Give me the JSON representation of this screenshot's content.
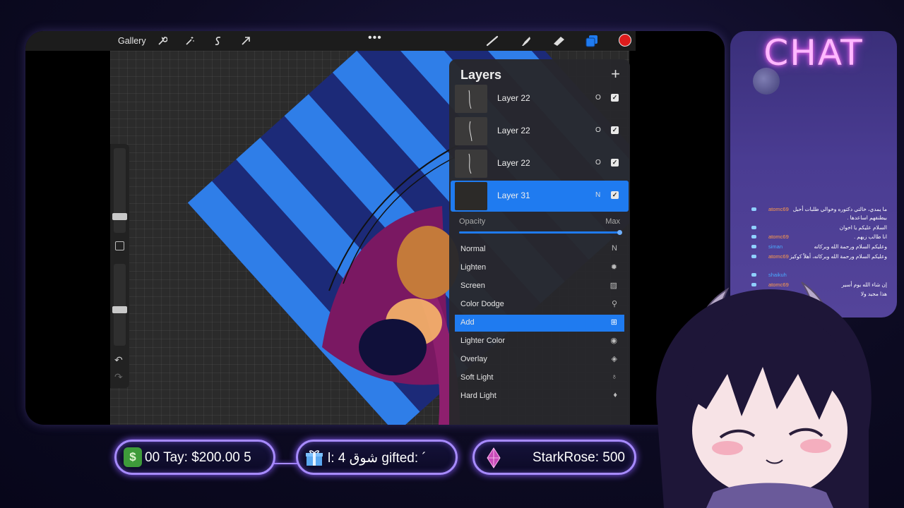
{
  "toolbar": {
    "gallery_label": "Gallery",
    "more_label": "•••",
    "icons": [
      "wrench-icon",
      "magic-wand-icon",
      "selection-icon",
      "transform-arrow-icon",
      "brush-icon",
      "smudge-icon",
      "eraser-icon",
      "layers-icon"
    ],
    "color_swatch": "#dd1c1c"
  },
  "layers": {
    "title": "Layers",
    "add_symbol": "+",
    "items": [
      {
        "name": "Layer 22",
        "mode": "O",
        "checked": "✓"
      },
      {
        "name": "Layer 22",
        "mode": "O",
        "checked": "✓"
      },
      {
        "name": "Layer 22",
        "mode": "O",
        "checked": "✓"
      },
      {
        "name": "Layer 31",
        "mode": "N",
        "checked": "✓"
      }
    ],
    "opacity_label": "Opacity",
    "opacity_max": "Max",
    "opacity_value": 1.0,
    "blend_modes": [
      "Normal",
      "Lighten",
      "Screen",
      "Color Dodge",
      "Add",
      "Lighter Color",
      "Overlay",
      "Soft Light",
      "Hard Light"
    ],
    "selected_blend": "Add"
  },
  "sidebar": {
    "undo_symbol": "↶",
    "redo_symbol": "↷"
  },
  "chat": {
    "title": "CHAT",
    "messages": [
      {
        "user": "atomc69",
        "text": "ما يمدي، خالتي دكتوره وخوالي طلبات أحبل"
      },
      {
        "user": "",
        "text": "بيطنقهم اساعدها ."
      },
      {
        "user": "",
        "text": "السلام عليكم يا اخوان"
      },
      {
        "user": "atomc69",
        "text": "انا طالب زيهم ."
      },
      {
        "user": "siman",
        "text": "وعليكم السلام ورحمة الله وبركاته"
      },
      {
        "user": "atomc69",
        "text": "وعليكم السلام ورحمة الله وبركاته، أهلاً كوكيز"
      },
      {
        "user": "shaikuh",
        "text": ""
      },
      {
        "user": "atomc69",
        "text": "إن شاء الله يوم أسير"
      },
      {
        "user": "",
        "text": "هذا مجيد ولا"
      }
    ]
  },
  "stats": {
    "tip_text": "00   Tay: $200.00      5",
    "money_symbol": "$",
    "gift_text": "l: 4          شوق gifted: ´",
    "sub_text": "StarkRose: 500"
  },
  "colors": {
    "accent": "#1f7bf0",
    "neon_border": "#a78bff",
    "chat_title": "#ffb8ff"
  }
}
